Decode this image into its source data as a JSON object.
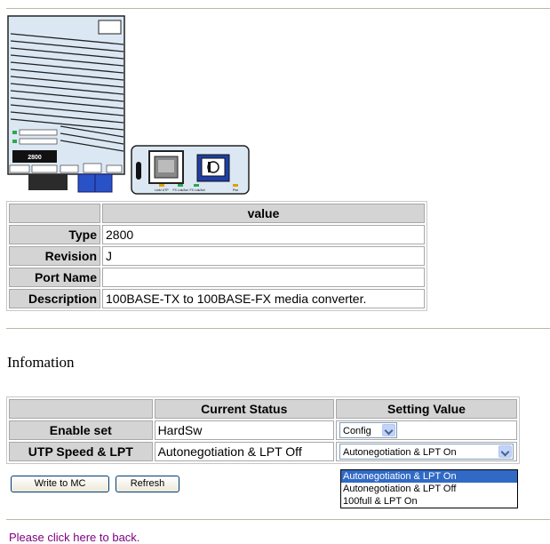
{
  "device_image": {
    "model_label": "2800",
    "port_labels": [
      "Link/ UTP",
      "FX Lnk/Act",
      "FX Lnk/Act",
      "Pwr"
    ]
  },
  "info_table": {
    "header": "value",
    "rows": [
      {
        "label": "Type",
        "value": "2800"
      },
      {
        "label": "Revision",
        "value": "J"
      },
      {
        "label": "Port Name",
        "value": ""
      },
      {
        "label": "Description",
        "value": "100BASE-TX to 100BASE-FX media converter."
      }
    ]
  },
  "section_heading": "Infomation",
  "status_table": {
    "headers": [
      "",
      "Current Status",
      "Setting Value"
    ],
    "rows": [
      {
        "label": "Enable set",
        "current": "HardSw",
        "setting": "Config"
      },
      {
        "label": "UTP Speed & LPT",
        "current": "Autonegotiation & LPT Off",
        "setting": "Autonegotiation & LPT On"
      }
    ]
  },
  "dropdown_options": [
    "Autonegotiation & LPT On",
    "Autonegotiation & LPT Off",
    "100full & LPT On"
  ],
  "buttons": {
    "write": "Write to MC",
    "refresh": "Refresh"
  },
  "back_link": "Please click here to back.",
  "colors": {
    "header_bg": "#d4d4d4",
    "link": "#800080",
    "selection": "#316ac5",
    "device_blue": "#dbe8f4"
  }
}
